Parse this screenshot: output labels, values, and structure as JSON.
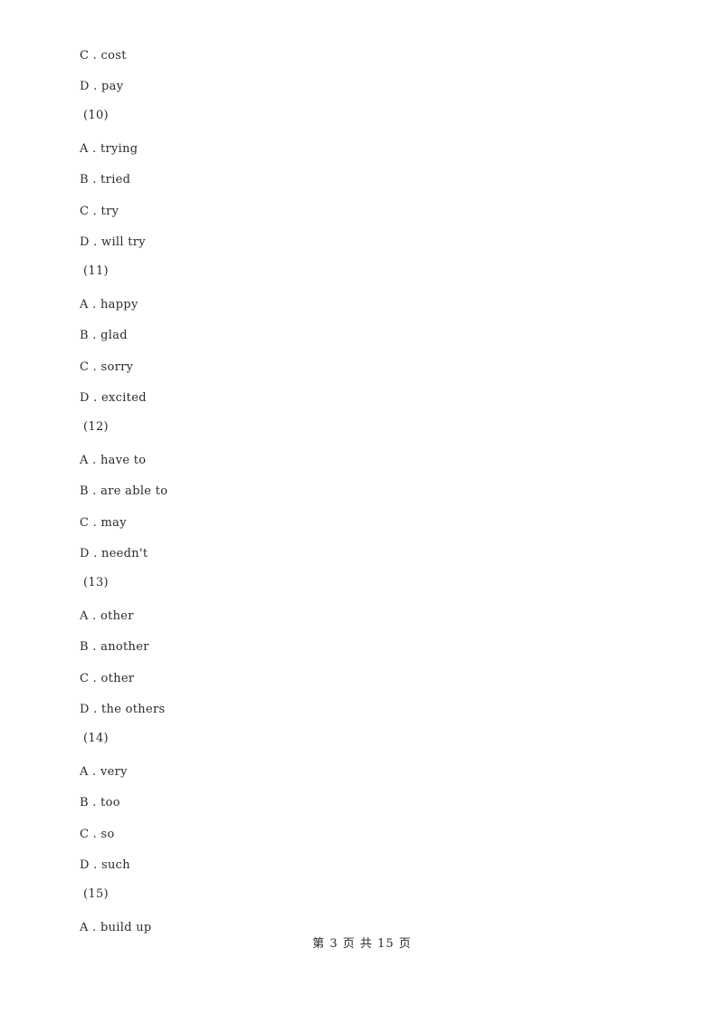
{
  "document": {
    "blocks": [
      {
        "type": "option",
        "letter": "C",
        "text": "C . cost"
      },
      {
        "type": "option",
        "letter": "D",
        "text": "D . pay"
      },
      {
        "type": "question",
        "text": "(10)"
      },
      {
        "type": "option",
        "letter": "A",
        "text": "A . trying"
      },
      {
        "type": "option",
        "letter": "B",
        "text": "B . tried"
      },
      {
        "type": "option",
        "letter": "C",
        "text": "C . try"
      },
      {
        "type": "option",
        "letter": "D",
        "text": "D . will try"
      },
      {
        "type": "question",
        "text": "(11)"
      },
      {
        "type": "option",
        "letter": "A",
        "text": "A . happy"
      },
      {
        "type": "option",
        "letter": "B",
        "text": "B . glad"
      },
      {
        "type": "option",
        "letter": "C",
        "text": "C . sorry"
      },
      {
        "type": "option",
        "letter": "D",
        "text": "D . excited"
      },
      {
        "type": "question",
        "text": "(12)"
      },
      {
        "type": "option",
        "letter": "A",
        "text": "A . have to"
      },
      {
        "type": "option",
        "letter": "B",
        "text": "B . are able to"
      },
      {
        "type": "option",
        "letter": "C",
        "text": "C . may"
      },
      {
        "type": "option",
        "letter": "D",
        "text": "D . needn't"
      },
      {
        "type": "question",
        "text": "(13)"
      },
      {
        "type": "option",
        "letter": "A",
        "text": "A . other"
      },
      {
        "type": "option",
        "letter": "B",
        "text": "B . another"
      },
      {
        "type": "option",
        "letter": "C",
        "text": "C . other"
      },
      {
        "type": "option",
        "letter": "D",
        "text": "D . the others"
      },
      {
        "type": "question",
        "text": "(14)"
      },
      {
        "type": "option",
        "letter": "A",
        "text": "A . very"
      },
      {
        "type": "option",
        "letter": "B",
        "text": "B . too"
      },
      {
        "type": "option",
        "letter": "C",
        "text": "C . so"
      },
      {
        "type": "option",
        "letter": "D",
        "text": "D . such"
      },
      {
        "type": "question",
        "text": "(15)"
      },
      {
        "type": "option",
        "letter": "A",
        "text": "A . build up"
      }
    ]
  },
  "footer": {
    "page_label": "第 3 页 共 15 页",
    "current_page": 3,
    "total_pages": 15
  }
}
